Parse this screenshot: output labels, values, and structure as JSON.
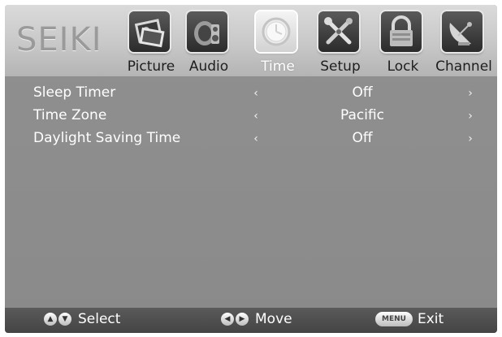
{
  "brand": {
    "logo_text": "SEIKI"
  },
  "tabs": [
    {
      "label": "Picture",
      "icon": "picture-icon",
      "active": false
    },
    {
      "label": "Audio",
      "icon": "audio-icon",
      "active": false
    },
    {
      "label": "Time",
      "icon": "clock-icon",
      "active": true
    },
    {
      "label": "Setup",
      "icon": "setup-tools-icon",
      "active": false
    },
    {
      "label": "Lock",
      "icon": "lock-icon",
      "active": false
    },
    {
      "label": "Channel",
      "icon": "satellite-dish-icon",
      "active": false
    }
  ],
  "menu": {
    "items": [
      {
        "label": "Sleep Timer",
        "value": "Off"
      },
      {
        "label": "Time Zone",
        "value": "Pacific"
      },
      {
        "label": "Daylight Saving Time",
        "value": "Off"
      }
    ],
    "left_arrow": "‹",
    "right_arrow": "›"
  },
  "footer": {
    "select_label": "Select",
    "move_label": "Move",
    "menu_button": "MENU",
    "exit_label": "Exit"
  },
  "colors": {
    "background": "#8c8c8c",
    "header": "#cfcfcf",
    "footer": "#4e4e4e",
    "text": "#ffffff"
  }
}
